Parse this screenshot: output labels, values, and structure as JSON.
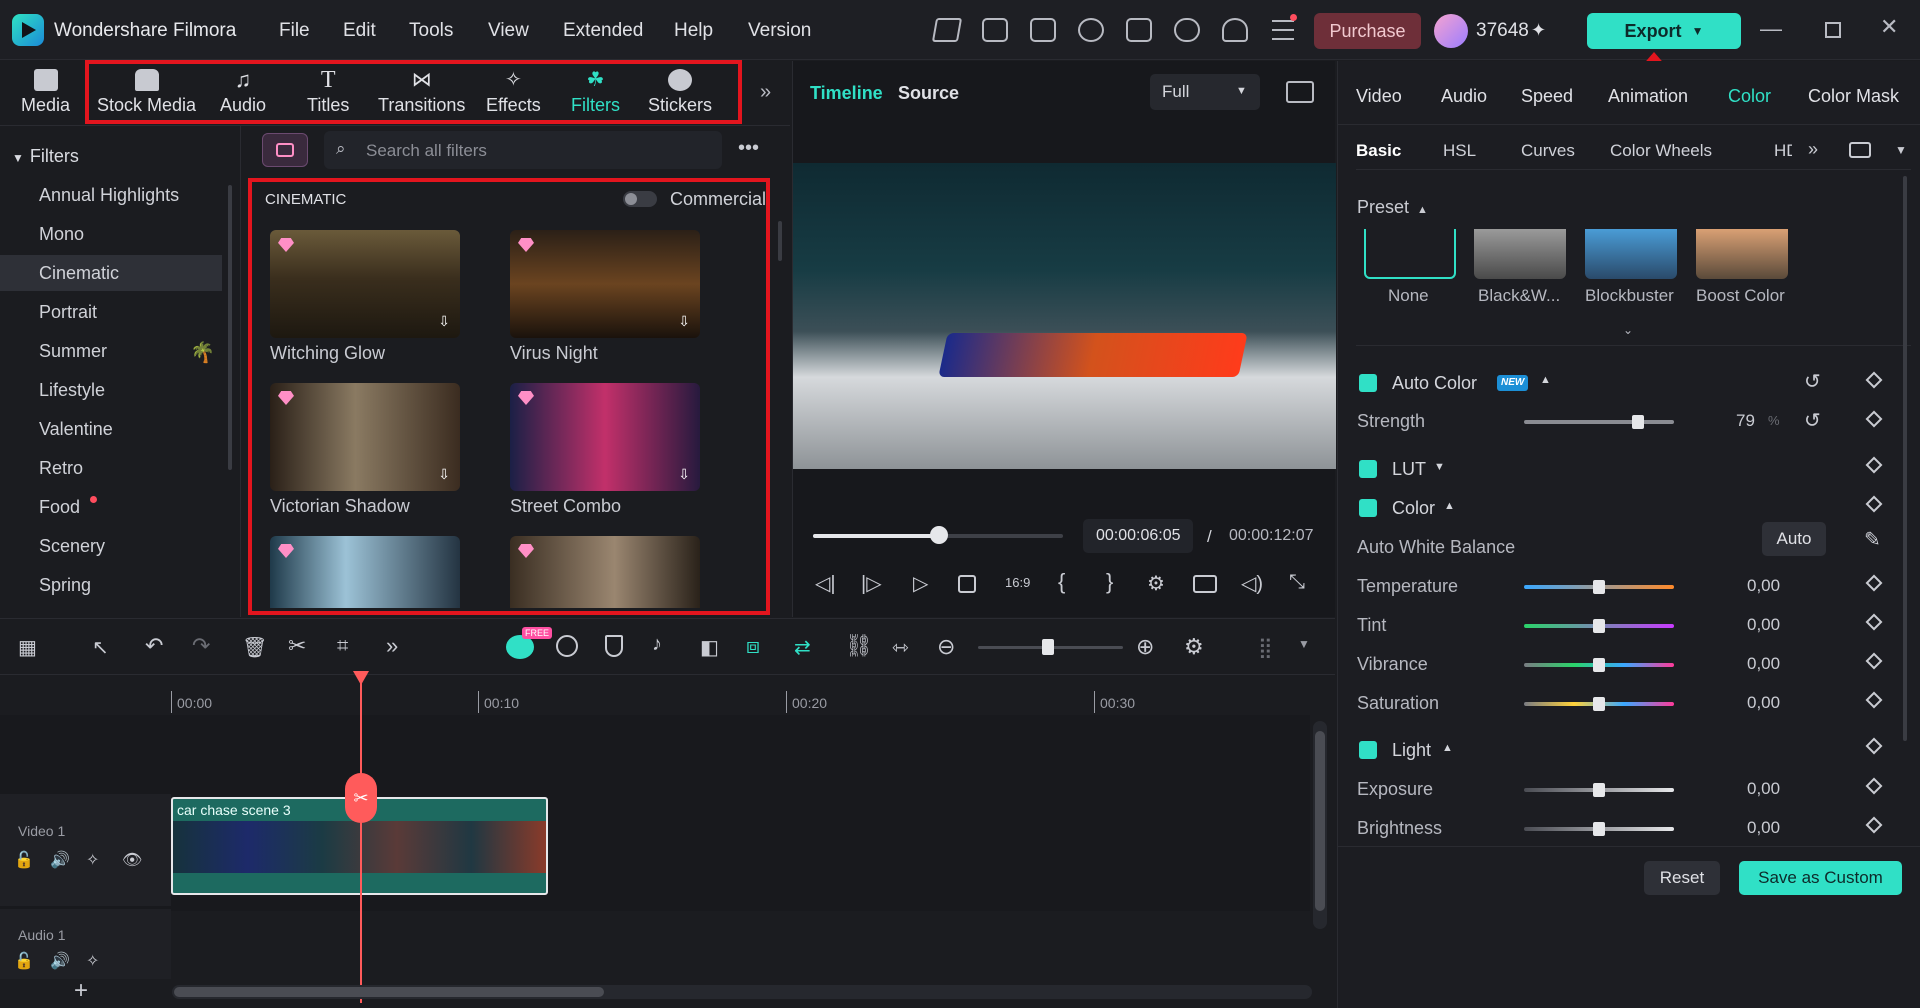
{
  "app": {
    "title": "Wondershare Filmora",
    "menus": [
      "File",
      "Edit",
      "Tools",
      "View",
      "Extended",
      "Help",
      "Version"
    ],
    "purchase": "Purchase",
    "credits": "37648",
    "export": "Export"
  },
  "media_tabs": [
    "Media",
    "Stock Media",
    "Audio",
    "Titles",
    "Transitions",
    "Effects",
    "Filters",
    "Stickers"
  ],
  "filters": {
    "header": "Filters",
    "categories": [
      "Annual Highlights",
      "Mono",
      "Cinematic",
      "Portrait",
      "Summer",
      "Lifestyle",
      "Valentine",
      "Retro",
      "Food",
      "Scenery",
      "Spring"
    ],
    "selected": "Cinematic",
    "search_placeholder": "Search all filters",
    "section": "CINEMATIC",
    "commercial": "Commercial",
    "items": [
      "Witching Glow",
      "Virus Night",
      "Victorian Shadow",
      "Street Combo"
    ]
  },
  "preview": {
    "tab_timeline": "Timeline",
    "tab_source": "Source",
    "quality": "Full",
    "current_time": "00:00:06:05",
    "sep": "/",
    "total_time": "00:00:12:07",
    "progress": 0.5
  },
  "timeline": {
    "ruler": [
      "00:00",
      "00:10",
      "00:20",
      "00:30"
    ],
    "clip_name": "car chase scene 3",
    "track_video": "Video 1",
    "track_audio": "Audio 1",
    "free_badge": "FREE"
  },
  "right": {
    "tabs": [
      "Video",
      "Audio",
      "Speed",
      "Animation",
      "Color",
      "Color Mask"
    ],
    "active_tab": "Color",
    "subtabs": [
      "Basic",
      "HSL",
      "Curves",
      "Color Wheels",
      "HDR"
    ],
    "preset_label": "Preset",
    "presets": [
      "None",
      "Black&W...",
      "Blockbuster",
      "Boost Color"
    ],
    "auto_color": "Auto Color",
    "new_badge": "NEW",
    "strength_label": "Strength",
    "strength": "79",
    "strength_unit": "%",
    "lut": "LUT",
    "color": "Color",
    "awb": "Auto White Balance",
    "auto_btn": "Auto",
    "color_rows": [
      {
        "label": "Temperature",
        "value": "0,00"
      },
      {
        "label": "Tint",
        "value": "0,00"
      },
      {
        "label": "Vibrance",
        "value": "0,00"
      },
      {
        "label": "Saturation",
        "value": "0,00"
      }
    ],
    "light": "Light",
    "light_rows": [
      {
        "label": "Exposure",
        "value": "0,00"
      },
      {
        "label": "Brightness",
        "value": "0,00"
      }
    ],
    "reset": "Reset",
    "save_custom": "Save as Custom"
  }
}
